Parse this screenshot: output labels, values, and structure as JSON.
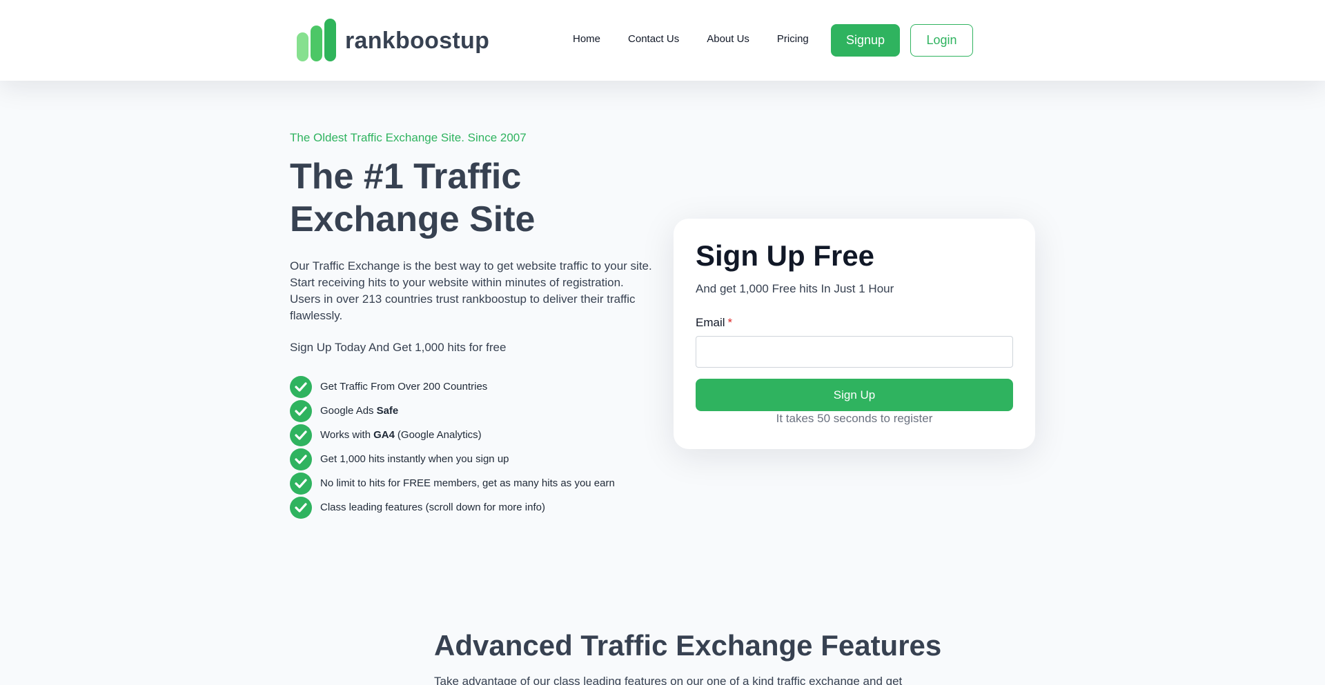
{
  "header": {
    "logo_text": "rankboostup",
    "nav": [
      "Home",
      "Contact Us",
      "About Us",
      "Pricing"
    ],
    "signup_label": "Signup",
    "login_label": "Login"
  },
  "hero": {
    "tagline": "The Oldest Traffic Exchange Site. Since 2007",
    "title": "The #1 Traffic Exchange Site",
    "description": "Our Traffic Exchange is the best way to get website traffic to your site. Start receiving hits to your website within minutes of registration. Users in over 213 countries trust rankboostup to deliver their traffic flawlessly.",
    "cta": "Sign Up Today And Get 1,000 hits for free",
    "features": [
      {
        "pre": "Get Traffic From Over 200 Countries",
        "bold": "",
        "post": ""
      },
      {
        "pre": "Google Ads",
        "bold": "Safe",
        "post": ""
      },
      {
        "pre": "Works with",
        "bold": "GA4",
        "post": "(Google Analytics)"
      },
      {
        "pre": "Get 1,000 hits instantly when you sign up",
        "bold": "",
        "post": ""
      },
      {
        "pre": "No limit to hits for FREE members, get as many hits as you earn",
        "bold": "",
        "post": ""
      },
      {
        "pre": "Class leading features (scroll down for more info)",
        "bold": "",
        "post": ""
      }
    ]
  },
  "signup_card": {
    "title": "Sign Up Free",
    "subtitle": "And get 1,000 Free hits In Just 1 Hour",
    "email_label": "Email",
    "required_mark": "*",
    "email_value": "",
    "button_label": "Sign Up",
    "note": "It takes 50 seconds to register"
  },
  "features_section": {
    "title": "Advanced Traffic Exchange Features",
    "description": "Take advantage of our class leading features on our one of a kind traffic exchange and get"
  },
  "colors": {
    "accent": "#2fb35f",
    "text": "#374151",
    "background": "#f8fafc"
  }
}
